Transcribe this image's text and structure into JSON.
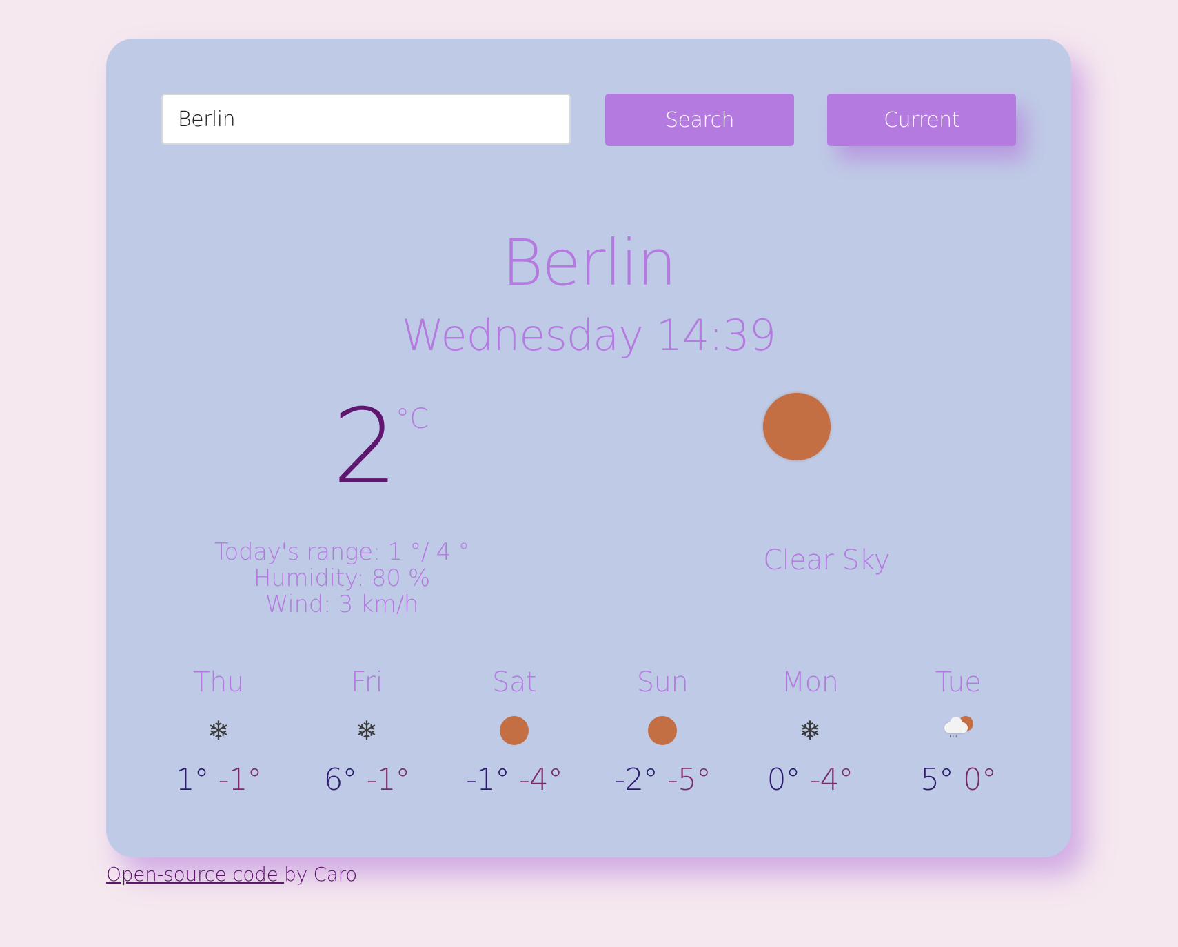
{
  "search": {
    "value": "Berlin",
    "search_label": "Search",
    "current_label": "Current"
  },
  "current": {
    "city": "Berlin",
    "datetime": "Wednesday 14:39",
    "temperature": "2",
    "unit": "°C",
    "range": "Today's range: 1 °/ 4 °",
    "humidity": "Humidity: 80 %",
    "wind": "Wind: 3 km/h",
    "condition": "Clear Sky",
    "icon": "sun-icon"
  },
  "forecast": [
    {
      "day": "Thu",
      "icon": "snowflake-icon",
      "max": "1°",
      "min": "-1°"
    },
    {
      "day": "Fri",
      "icon": "snowflake-icon",
      "max": "6°",
      "min": "-1°"
    },
    {
      "day": "Sat",
      "icon": "sun-icon",
      "max": "-1°",
      "min": "-4°"
    },
    {
      "day": "Sun",
      "icon": "sun-icon",
      "max": "-2°",
      "min": "-5°"
    },
    {
      "day": "Mon",
      "icon": "snowflake-icon",
      "max": "0°",
      "min": "-4°"
    },
    {
      "day": "Tue",
      "icon": "sun-cloud-rain-icon",
      "max": "5°",
      "min": "0°"
    }
  ],
  "footer": {
    "link_text": "Open-source code ",
    "suffix": "by Caro"
  },
  "colors": {
    "background": "#f5e8ef",
    "card": "#bfcbe6",
    "accent": "#b57ae0",
    "temp": "#5e166f",
    "sun": "#c46e44"
  }
}
